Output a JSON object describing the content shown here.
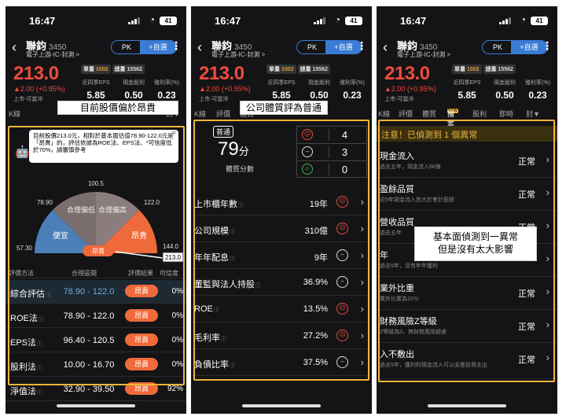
{
  "status": {
    "time": "16:47",
    "battery": "41"
  },
  "stock": {
    "name": "聯鈞",
    "code": "3450",
    "sector": "電子上游-IC-封測 >",
    "pk_label": "PK",
    "watch_label": "+自選",
    "price": "213.0",
    "change": "▲2.00 (+0.95%)",
    "market": "上市-可當沖",
    "vol_single_label": "單量",
    "vol_single": "1002",
    "vol_total_label": "總量",
    "vol_total": "15562",
    "metrics": [
      {
        "label": "近四季EPS",
        "value": "5.85"
      },
      {
        "label": "現金股利",
        "value": "0.50"
      },
      {
        "label": "殖利率(%)",
        "value": "0.23"
      }
    ]
  },
  "tabs1": {
    "t1": "K線",
    "t5": "封▼"
  },
  "tabs2": {
    "t1": "K線",
    "t2": "評價",
    "t3": "體質"
  },
  "tabs3": {
    "t1": "K線",
    "t2": "評價",
    "t3": "體質",
    "t4": "播客",
    "t4_badge": "NEW",
    "t5": "股利",
    "t6": "即時",
    "t7": "封▼"
  },
  "panel1": {
    "label": "目前股價偏於昂貴",
    "tip": "目前股價213.0元，相對於基本面估值78.90-122.0元是「昂貴」的，評估依據為ROE法、EPS法、*可信度低於70%，請審慎參考",
    "gauge": {
      "ticks": [
        "100.5",
        "78.90",
        "122.0",
        "57.30",
        "144.0"
      ],
      "zones": [
        "便宜",
        "合理偏低",
        "合理偏高",
        "昂貴"
      ],
      "current_label": "昂貴",
      "current_value": "213.0"
    },
    "table": {
      "headers": [
        "評價方法",
        "合理區間",
        "評價結果",
        "可信度"
      ],
      "rows": [
        {
          "method": "綜合評估",
          "range": "78.90 - 122.0",
          "result": "昂貴",
          "conf": "0%"
        },
        {
          "method": "ROE法",
          "range": "78.90 - 122.0",
          "result": "昂貴",
          "conf": "0%"
        },
        {
          "method": "EPS法",
          "range": "96.40 - 120.5",
          "result": "昂貴",
          "conf": "0%"
        },
        {
          "method": "股利法",
          "range": "10.00 - 16.70",
          "result": "昂貴",
          "conf": "0%"
        },
        {
          "method": "淨值法",
          "range": "32.90 - 39.50",
          "result": "昂貴",
          "conf": "92%"
        }
      ]
    }
  },
  "panel2": {
    "label": "公司體質評為普通",
    "tag": "普通",
    "score": "79",
    "score_unit": "分",
    "score_label": "體質分數",
    "counts": [
      {
        "icon": "bad",
        "value": "4"
      },
      {
        "icon": "neutral",
        "value": "3"
      },
      {
        "icon": "good",
        "value": "0"
      }
    ],
    "items": [
      {
        "label": "上市櫃年數",
        "value": "19年",
        "face": "bad"
      },
      {
        "label": "公司規模",
        "value": "310億",
        "face": "bad"
      },
      {
        "label": "年年配息",
        "value": "9年",
        "face": "neutral"
      },
      {
        "label": "董監與法人持股",
        "value": "36.9%",
        "face": "neutral"
      },
      {
        "label": "ROE",
        "value": "13.5%",
        "face": "bad"
      },
      {
        "label": "毛利率",
        "value": "27.2%",
        "face": "bad"
      },
      {
        "label": "負債比率",
        "value": "37.5%",
        "face": "neutral"
      }
    ]
  },
  "panel3": {
    "alert": "注意！已偵測到 1 個異常",
    "note": "基本面偵測到一異常\n但是沒有太大影響",
    "items": [
      {
        "title": "現金流入",
        "sub": "過去五年，現金流入66億",
        "status": "正常"
      },
      {
        "title": "盈餘品質",
        "sub": "近5年現金流入皆大於會計盈餘",
        "status": "正常"
      },
      {
        "title": "營收品質",
        "sub": "過去五年",
        "status": "正常"
      },
      {
        "title": "年",
        "sub": "過去5年，沒有年年獲利",
        "status": ""
      },
      {
        "title": "業外比重",
        "sub": "業外比重為10％",
        "status": "正常"
      },
      {
        "title": "財務風險Z等級",
        "sub": "Z等級為3，無財務風險疑慮",
        "status": "正常"
      },
      {
        "title": "入不敷出",
        "sub": "過去5年，獲利的現金流入可以支應投資支出",
        "status": "正常"
      }
    ]
  },
  "colors": {
    "up": "#f04b3c",
    "accent": "#3a7bd5",
    "highlight": "#f0b53a",
    "expensive": "#ef6a3a"
  }
}
